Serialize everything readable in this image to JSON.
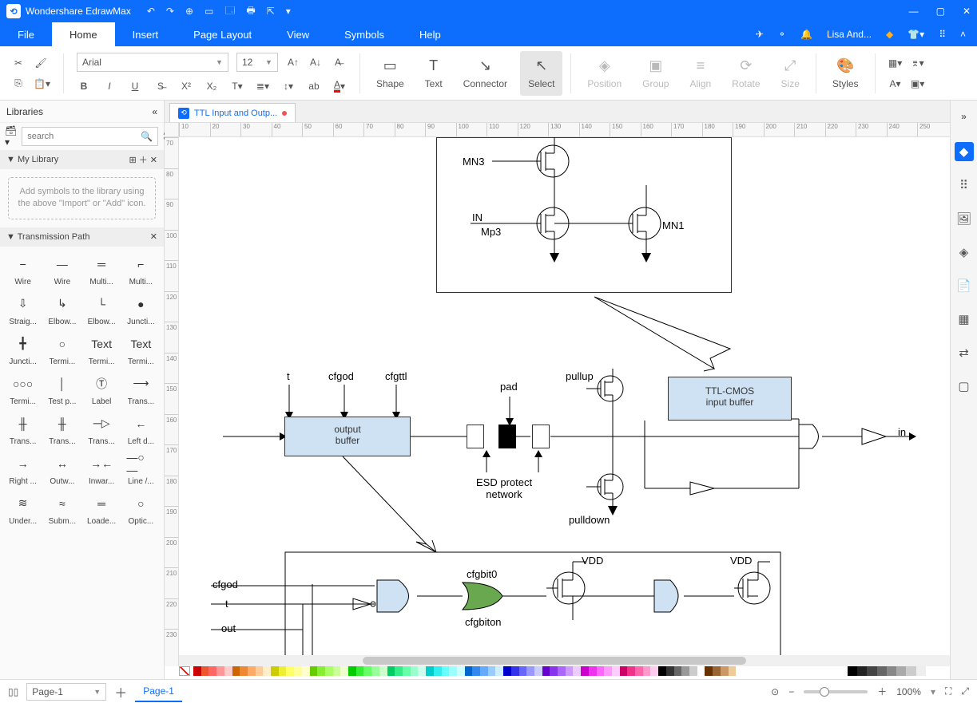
{
  "app": {
    "title": "Wondershare EdrawMax"
  },
  "window": {
    "min": "—",
    "max": "▢",
    "close": "✕"
  },
  "qat": [
    "↶",
    "↷",
    "⊕",
    "▭",
    "🗔",
    "🖶",
    "⇱",
    "▾"
  ],
  "menu": {
    "tabs": [
      "File",
      "Home",
      "Insert",
      "Page Layout",
      "View",
      "Symbols",
      "Help"
    ],
    "active": 1,
    "user": "Lisa And...",
    "icons": [
      "✈",
      "⚬",
      "🔔"
    ]
  },
  "toolbar": {
    "font": "Arial",
    "size": "12",
    "shape": "Shape",
    "text": "Text",
    "connector": "Connector",
    "select": "Select",
    "position": "Position",
    "group": "Group",
    "align": "Align",
    "rotate": "Rotate",
    "size_lbl": "Size",
    "styles": "Styles"
  },
  "sidebar": {
    "title": "Libraries",
    "search_placeholder": "search",
    "mylib": "My Library",
    "hint": "Add symbols to the library using the above \"Import\" or \"Add\" icon.",
    "section": "Transmission Path",
    "items": [
      {
        "l": "Wire",
        "g": "⎯"
      },
      {
        "l": "Wire",
        "g": "—"
      },
      {
        "l": "Multi...",
        "g": "═"
      },
      {
        "l": "Multi...",
        "g": "⌐"
      },
      {
        "l": "Straig...",
        "g": "⇩"
      },
      {
        "l": "Elbow...",
        "g": "↳"
      },
      {
        "l": "Elbow...",
        "g": "└"
      },
      {
        "l": "Juncti...",
        "g": "●"
      },
      {
        "l": "Juncti...",
        "g": "╋"
      },
      {
        "l": "Termi...",
        "g": "○"
      },
      {
        "l": "Termi...",
        "g": "Text"
      },
      {
        "l": "Termi...",
        "g": "Text"
      },
      {
        "l": "Termi...",
        "g": "○○○"
      },
      {
        "l": "Test p...",
        "g": "│"
      },
      {
        "l": "Label",
        "g": "Ⓣ"
      },
      {
        "l": "Trans...",
        "g": "⟶"
      },
      {
        "l": "Trans...",
        "g": "╫"
      },
      {
        "l": "Trans...",
        "g": "╫"
      },
      {
        "l": "Trans...",
        "g": "─▷"
      },
      {
        "l": "Left d...",
        "g": "←"
      },
      {
        "l": "Right ...",
        "g": "→"
      },
      {
        "l": "Outw...",
        "g": "↔"
      },
      {
        "l": "Inwar...",
        "g": "→←"
      },
      {
        "l": "Line /...",
        "g": "—○—"
      },
      {
        "l": "Under...",
        "g": "≋"
      },
      {
        "l": "Subm...",
        "g": "≈"
      },
      {
        "l": "Loade...",
        "g": "═"
      },
      {
        "l": "Optic...",
        "g": "○"
      }
    ]
  },
  "doc": {
    "tab": "TTL Input and Outp...",
    "page": "Page-1"
  },
  "ruler_ticks": [
    "10",
    "20",
    "30",
    "40",
    "50",
    "60",
    "70",
    "80",
    "90",
    "100",
    "110",
    "120",
    "130",
    "140",
    "150",
    "160",
    "170",
    "180",
    "190",
    "200",
    "210",
    "220",
    "230",
    "240",
    "250"
  ],
  "ruler_ticks_v": [
    "70",
    "80",
    "90",
    "100",
    "110",
    "120",
    "130",
    "140",
    "150",
    "160",
    "170",
    "180",
    "190",
    "200",
    "210",
    "220",
    "230"
  ],
  "canvas": {
    "mn3": "MN3",
    "in": "IN",
    "mp3": "Mp3",
    "mn1": "MN1",
    "t": "t",
    "cfgod": "cfgod",
    "cfgttl": "cfgttl",
    "pad": "pad",
    "pullup": "pullup",
    "pulldown": "pulldown",
    "output_buffer_l1": "output",
    "output_buffer_l2": "buffer",
    "ttl_l1": "TTL-CMOS",
    "ttl_l2": "input buffer",
    "esd_l1": "ESD protect",
    "esd_l2": "network",
    "in_lbl": "in",
    "cfgod2": "cfgod",
    "t2": "t",
    "out": "out",
    "cfgbit0": "cfgbit0",
    "cfgbiton": "cfgbiton",
    "vdd1": "VDD",
    "vdd2": "VDD"
  },
  "status": {
    "zoom": "100%",
    "page": "Page-1"
  },
  "palette_colors": [
    "#c00",
    "#e53",
    "#f66",
    "#f99",
    "#fcc",
    "#c60",
    "#e83",
    "#fa6",
    "#fc9",
    "#fec",
    "#cc0",
    "#ee3",
    "#ff6",
    "#ff9",
    "#ffc",
    "#6c0",
    "#8e3",
    "#af6",
    "#cf9",
    "#efc",
    "#0c0",
    "#3e3",
    "#6f6",
    "#9f9",
    "#cfc",
    "#0c6",
    "#3e8",
    "#6fa",
    "#9fc",
    "#cfe",
    "#0cc",
    "#3ee",
    "#6ff",
    "#9ff",
    "#cff",
    "#06c",
    "#38e",
    "#6af",
    "#9cf",
    "#cef",
    "#00c",
    "#33e",
    "#66f",
    "#99f",
    "#ccf",
    "#60c",
    "#83e",
    "#a6f",
    "#c9f",
    "#ecf",
    "#c0c",
    "#e3e",
    "#f6f",
    "#f9f",
    "#fcf",
    "#c06",
    "#e38",
    "#f6a",
    "#f9c",
    "#fce",
    "#000",
    "#333",
    "#666",
    "#999",
    "#ccc",
    "#fff",
    "#630",
    "#963",
    "#c96",
    "#ec9"
  ],
  "palette_grays": [
    "#000",
    "#222",
    "#444",
    "#666",
    "#888",
    "#aaa",
    "#ccc",
    "#eee",
    "#fff"
  ]
}
